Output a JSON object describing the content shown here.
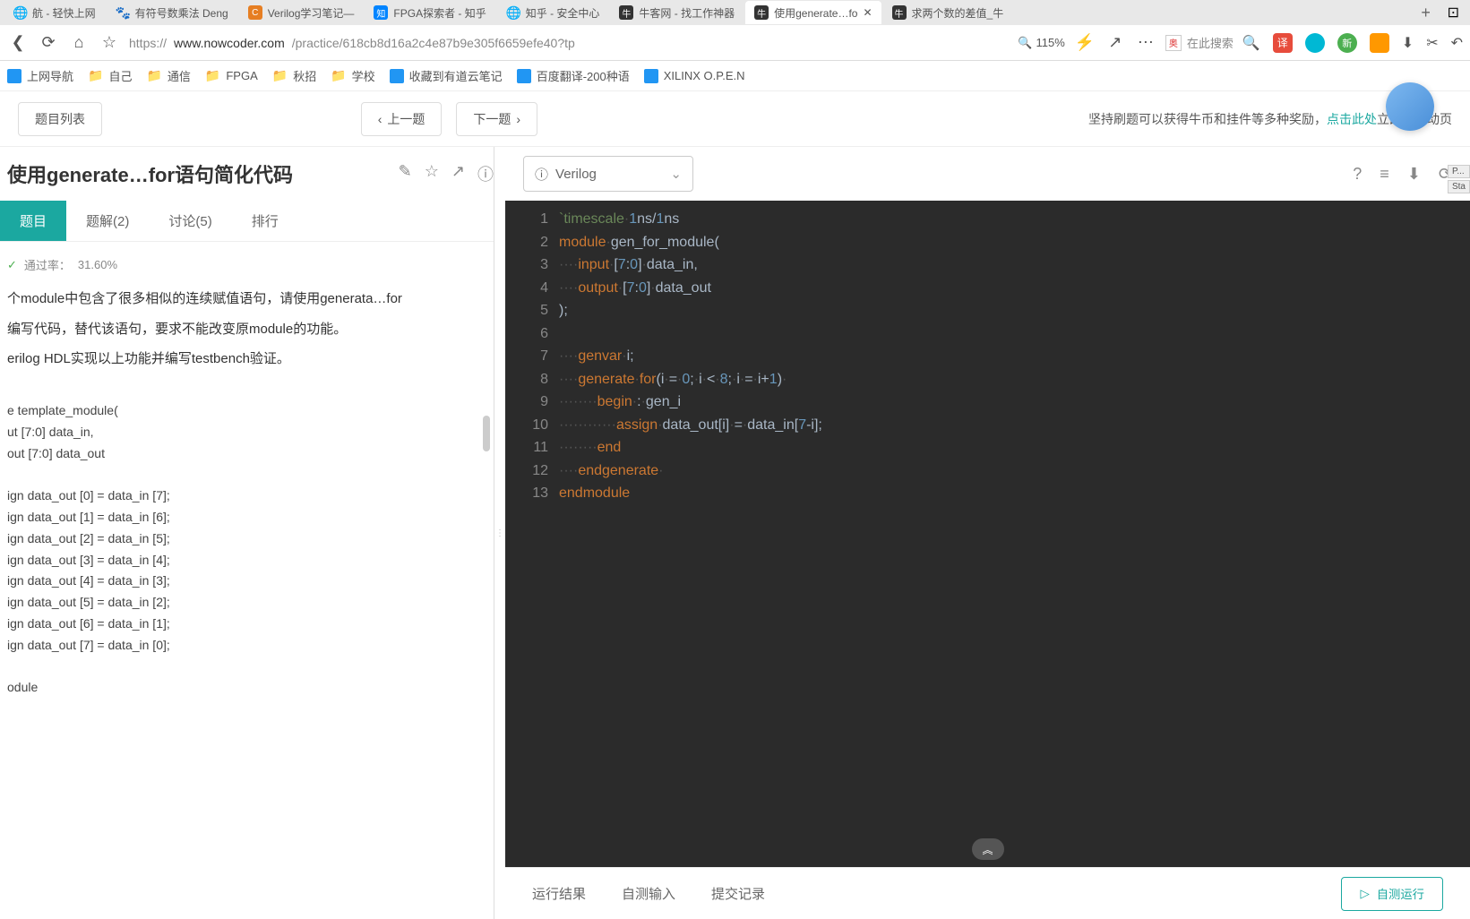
{
  "tabs": [
    {
      "label": "航 - 轻快上网",
      "icon": "🌐"
    },
    {
      "label": "有符号数乘法 Deng",
      "icon": "🐾"
    },
    {
      "label": "Verilog学习笔记—",
      "icon": "C"
    },
    {
      "label": "FPGA探索者 - 知乎",
      "icon": "知"
    },
    {
      "label": "知乎 - 安全中心",
      "icon": "🌐"
    },
    {
      "label": "牛客网 - 找工作神器",
      "icon": "牛"
    },
    {
      "label": "使用generate…fo",
      "icon": "牛"
    },
    {
      "label": "求两个数的差值_牛",
      "icon": "牛"
    }
  ],
  "url": {
    "protocol": "https://",
    "domain": "www.nowcoder.com",
    "path": "/practice/618cb8d16a2c4e87b9e305f6659efe40?tp"
  },
  "zoom": "115%",
  "search_placeholder": "在此搜索",
  "bookmarks": [
    {
      "label": "上网导航",
      "type": "link"
    },
    {
      "label": "自己",
      "type": "folder"
    },
    {
      "label": "通信",
      "type": "folder"
    },
    {
      "label": "FPGA",
      "type": "folder"
    },
    {
      "label": "秋招",
      "type": "folder"
    },
    {
      "label": "学校",
      "type": "folder"
    },
    {
      "label": "收藏到有道云笔记",
      "type": "link"
    },
    {
      "label": "百度翻译-200种语",
      "type": "link"
    },
    {
      "label": "XILINX O.P.E.N",
      "type": "link"
    }
  ],
  "header": {
    "list_btn": "题目列表",
    "prev": "上一题",
    "next": "下一题",
    "reward_text": "坚持刷题可以获得牛币和挂件等多种奖励，",
    "reward_link": "点击此处",
    "reward_suffix": "立即设活动页"
  },
  "problem": {
    "title": "使用generate…for语句简化代码",
    "tabs": [
      "题目",
      "题解(2)",
      "讨论(5)",
      "排行"
    ],
    "pass_label": "通过率：",
    "pass_rate": "31.60%",
    "desc1": "个module中包含了很多相似的连续赋值语句，请使用generata…for",
    "desc2": "编写代码，替代该语句，要求不能改变原module的功能。",
    "desc3": "erilog HDL实现以上功能并编写testbench验证。",
    "code": [
      "e template_module(",
      "ut [7:0] data_in,",
      "out [7:0] data_out",
      "",
      "ign data_out [0] = data_in [7];",
      "ign data_out [1] = data_in [6];",
      "ign data_out [2] = data_in [5];",
      "ign data_out [3] = data_in [4];",
      "ign data_out [4] = data_in [3];",
      "ign data_out [5] = data_in [2];",
      "ign data_out [6] = data_in [1];",
      "ign data_out [7] = data_in [0];",
      "",
      "odule"
    ]
  },
  "editor": {
    "language": "Verilog",
    "tags": [
      "P...",
      "Sta"
    ],
    "footer_tabs": [
      "运行结果",
      "自测输入",
      "提交记录"
    ],
    "run_btn": "自测运行"
  },
  "code": {
    "lines": [
      {
        "n": 1,
        "tokens": [
          {
            "t": "`timescale",
            "c": "tok-str"
          },
          {
            "t": "·",
            "c": "tok-dot"
          },
          {
            "t": "1",
            "c": "tok-num"
          },
          {
            "t": "ns/",
            "c": "tok-id"
          },
          {
            "t": "1",
            "c": "tok-num"
          },
          {
            "t": "ns",
            "c": "tok-id"
          }
        ]
      },
      {
        "n": 2,
        "tokens": [
          {
            "t": "module",
            "c": "tok-kw"
          },
          {
            "t": "·",
            "c": "tok-dot"
          },
          {
            "t": "gen_for_module(",
            "c": "tok-id"
          }
        ]
      },
      {
        "n": 3,
        "tokens": [
          {
            "t": "····",
            "c": "tok-dot"
          },
          {
            "t": "input",
            "c": "tok-kw"
          },
          {
            "t": "·",
            "c": "tok-dot"
          },
          {
            "t": "[",
            "c": "tok-punc"
          },
          {
            "t": "7",
            "c": "tok-num"
          },
          {
            "t": ":",
            "c": "tok-punc"
          },
          {
            "t": "0",
            "c": "tok-num"
          },
          {
            "t": "]",
            "c": "tok-punc"
          },
          {
            "t": "·",
            "c": "tok-dot"
          },
          {
            "t": "data_in,",
            "c": "tok-id"
          }
        ]
      },
      {
        "n": 4,
        "tokens": [
          {
            "t": "····",
            "c": "tok-dot"
          },
          {
            "t": "output",
            "c": "tok-kw"
          },
          {
            "t": "·",
            "c": "tok-dot"
          },
          {
            "t": "[",
            "c": "tok-punc"
          },
          {
            "t": "7",
            "c": "tok-num"
          },
          {
            "t": ":",
            "c": "tok-punc"
          },
          {
            "t": "0",
            "c": "tok-num"
          },
          {
            "t": "]",
            "c": "tok-punc"
          },
          {
            "t": "·",
            "c": "tok-dot"
          },
          {
            "t": "data_out",
            "c": "tok-id"
          }
        ]
      },
      {
        "n": 5,
        "tokens": [
          {
            "t": ");",
            "c": "tok-punc"
          }
        ]
      },
      {
        "n": 6,
        "tokens": []
      },
      {
        "n": 7,
        "tokens": [
          {
            "t": "····",
            "c": "tok-dot"
          },
          {
            "t": "genvar",
            "c": "tok-kw"
          },
          {
            "t": "·",
            "c": "tok-dot"
          },
          {
            "t": "i;",
            "c": "tok-id"
          }
        ]
      },
      {
        "n": 8,
        "tokens": [
          {
            "t": "····",
            "c": "tok-dot"
          },
          {
            "t": "generate",
            "c": "tok-kw"
          },
          {
            "t": "·",
            "c": "tok-dot"
          },
          {
            "t": "for",
            "c": "tok-kw"
          },
          {
            "t": "(i",
            "c": "tok-id"
          },
          {
            "t": "·",
            "c": "tok-dot"
          },
          {
            "t": "=",
            "c": "tok-op"
          },
          {
            "t": "·",
            "c": "tok-dot"
          },
          {
            "t": "0",
            "c": "tok-num"
          },
          {
            "t": ";",
            "c": "tok-punc"
          },
          {
            "t": "·",
            "c": "tok-dot"
          },
          {
            "t": "i",
            "c": "tok-id"
          },
          {
            "t": "·",
            "c": "tok-dot"
          },
          {
            "t": "<",
            "c": "tok-op"
          },
          {
            "t": "·",
            "c": "tok-dot"
          },
          {
            "t": "8",
            "c": "tok-num"
          },
          {
            "t": ";",
            "c": "tok-punc"
          },
          {
            "t": "·",
            "c": "tok-dot"
          },
          {
            "t": "i",
            "c": "tok-id"
          },
          {
            "t": "·",
            "c": "tok-dot"
          },
          {
            "t": "=",
            "c": "tok-op"
          },
          {
            "t": "·",
            "c": "tok-dot"
          },
          {
            "t": "i+",
            "c": "tok-id"
          },
          {
            "t": "1",
            "c": "tok-num"
          },
          {
            "t": ")",
            "c": "tok-punc"
          },
          {
            "t": "·",
            "c": "tok-dot"
          }
        ]
      },
      {
        "n": 9,
        "tokens": [
          {
            "t": "········",
            "c": "tok-dot"
          },
          {
            "t": "begin",
            "c": "tok-kw"
          },
          {
            "t": "·",
            "c": "tok-dot"
          },
          {
            "t": ":",
            "c": "tok-punc"
          },
          {
            "t": "·",
            "c": "tok-dot"
          },
          {
            "t": "gen_i",
            "c": "tok-id"
          }
        ]
      },
      {
        "n": 10,
        "tokens": [
          {
            "t": "············",
            "c": "tok-dot"
          },
          {
            "t": "assign",
            "c": "tok-kw"
          },
          {
            "t": "·",
            "c": "tok-dot"
          },
          {
            "t": "data_out[i]",
            "c": "tok-id"
          },
          {
            "t": "·",
            "c": "tok-dot"
          },
          {
            "t": "=",
            "c": "tok-op"
          },
          {
            "t": "·",
            "c": "tok-dot"
          },
          {
            "t": "data_in[",
            "c": "tok-id"
          },
          {
            "t": "7",
            "c": "tok-num"
          },
          {
            "t": "-i];",
            "c": "tok-id"
          }
        ]
      },
      {
        "n": 11,
        "tokens": [
          {
            "t": "········",
            "c": "tok-dot"
          },
          {
            "t": "end",
            "c": "tok-kw"
          }
        ]
      },
      {
        "n": 12,
        "tokens": [
          {
            "t": "····",
            "c": "tok-dot"
          },
          {
            "t": "endgenerate",
            "c": "tok-kw"
          },
          {
            "t": "·",
            "c": "tok-dot"
          }
        ]
      },
      {
        "n": 13,
        "tokens": [
          {
            "t": "endmodule",
            "c": "tok-kw"
          }
        ]
      }
    ]
  }
}
